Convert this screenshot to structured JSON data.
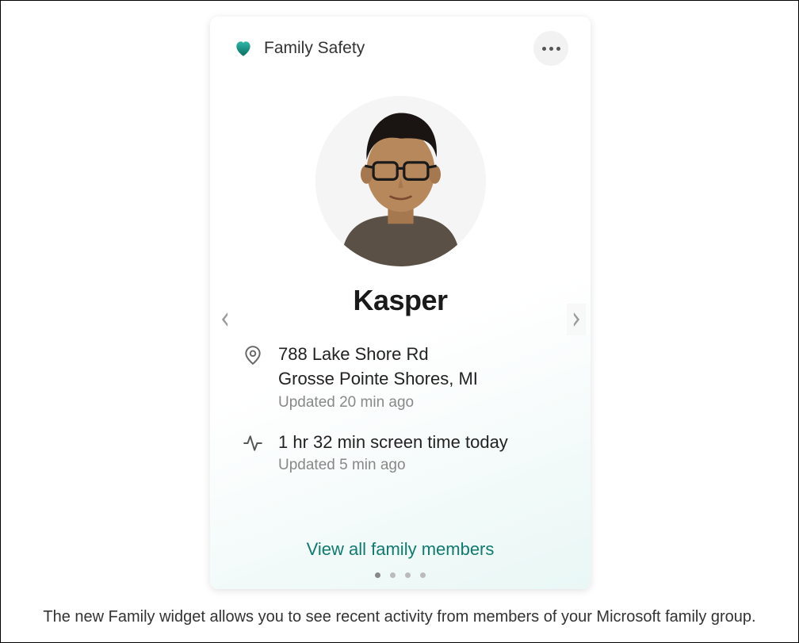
{
  "widget": {
    "title": "Family Safety",
    "member": {
      "name": "Kasper",
      "location": {
        "line1": "788 Lake Shore Rd",
        "line2": "Grosse Pointe Shores, MI",
        "updated": "Updated 20 min ago"
      },
      "screentime": {
        "value": "1 hr 32 min screen time today",
        "updated": "Updated 5 min ago"
      }
    },
    "view_all_label": "View all family members",
    "page_count": 4,
    "active_page": 0
  },
  "caption": "The new Family widget allows you to see recent activity from members of your Microsoft family group.",
  "colors": {
    "accent": "#0f7a6e"
  }
}
